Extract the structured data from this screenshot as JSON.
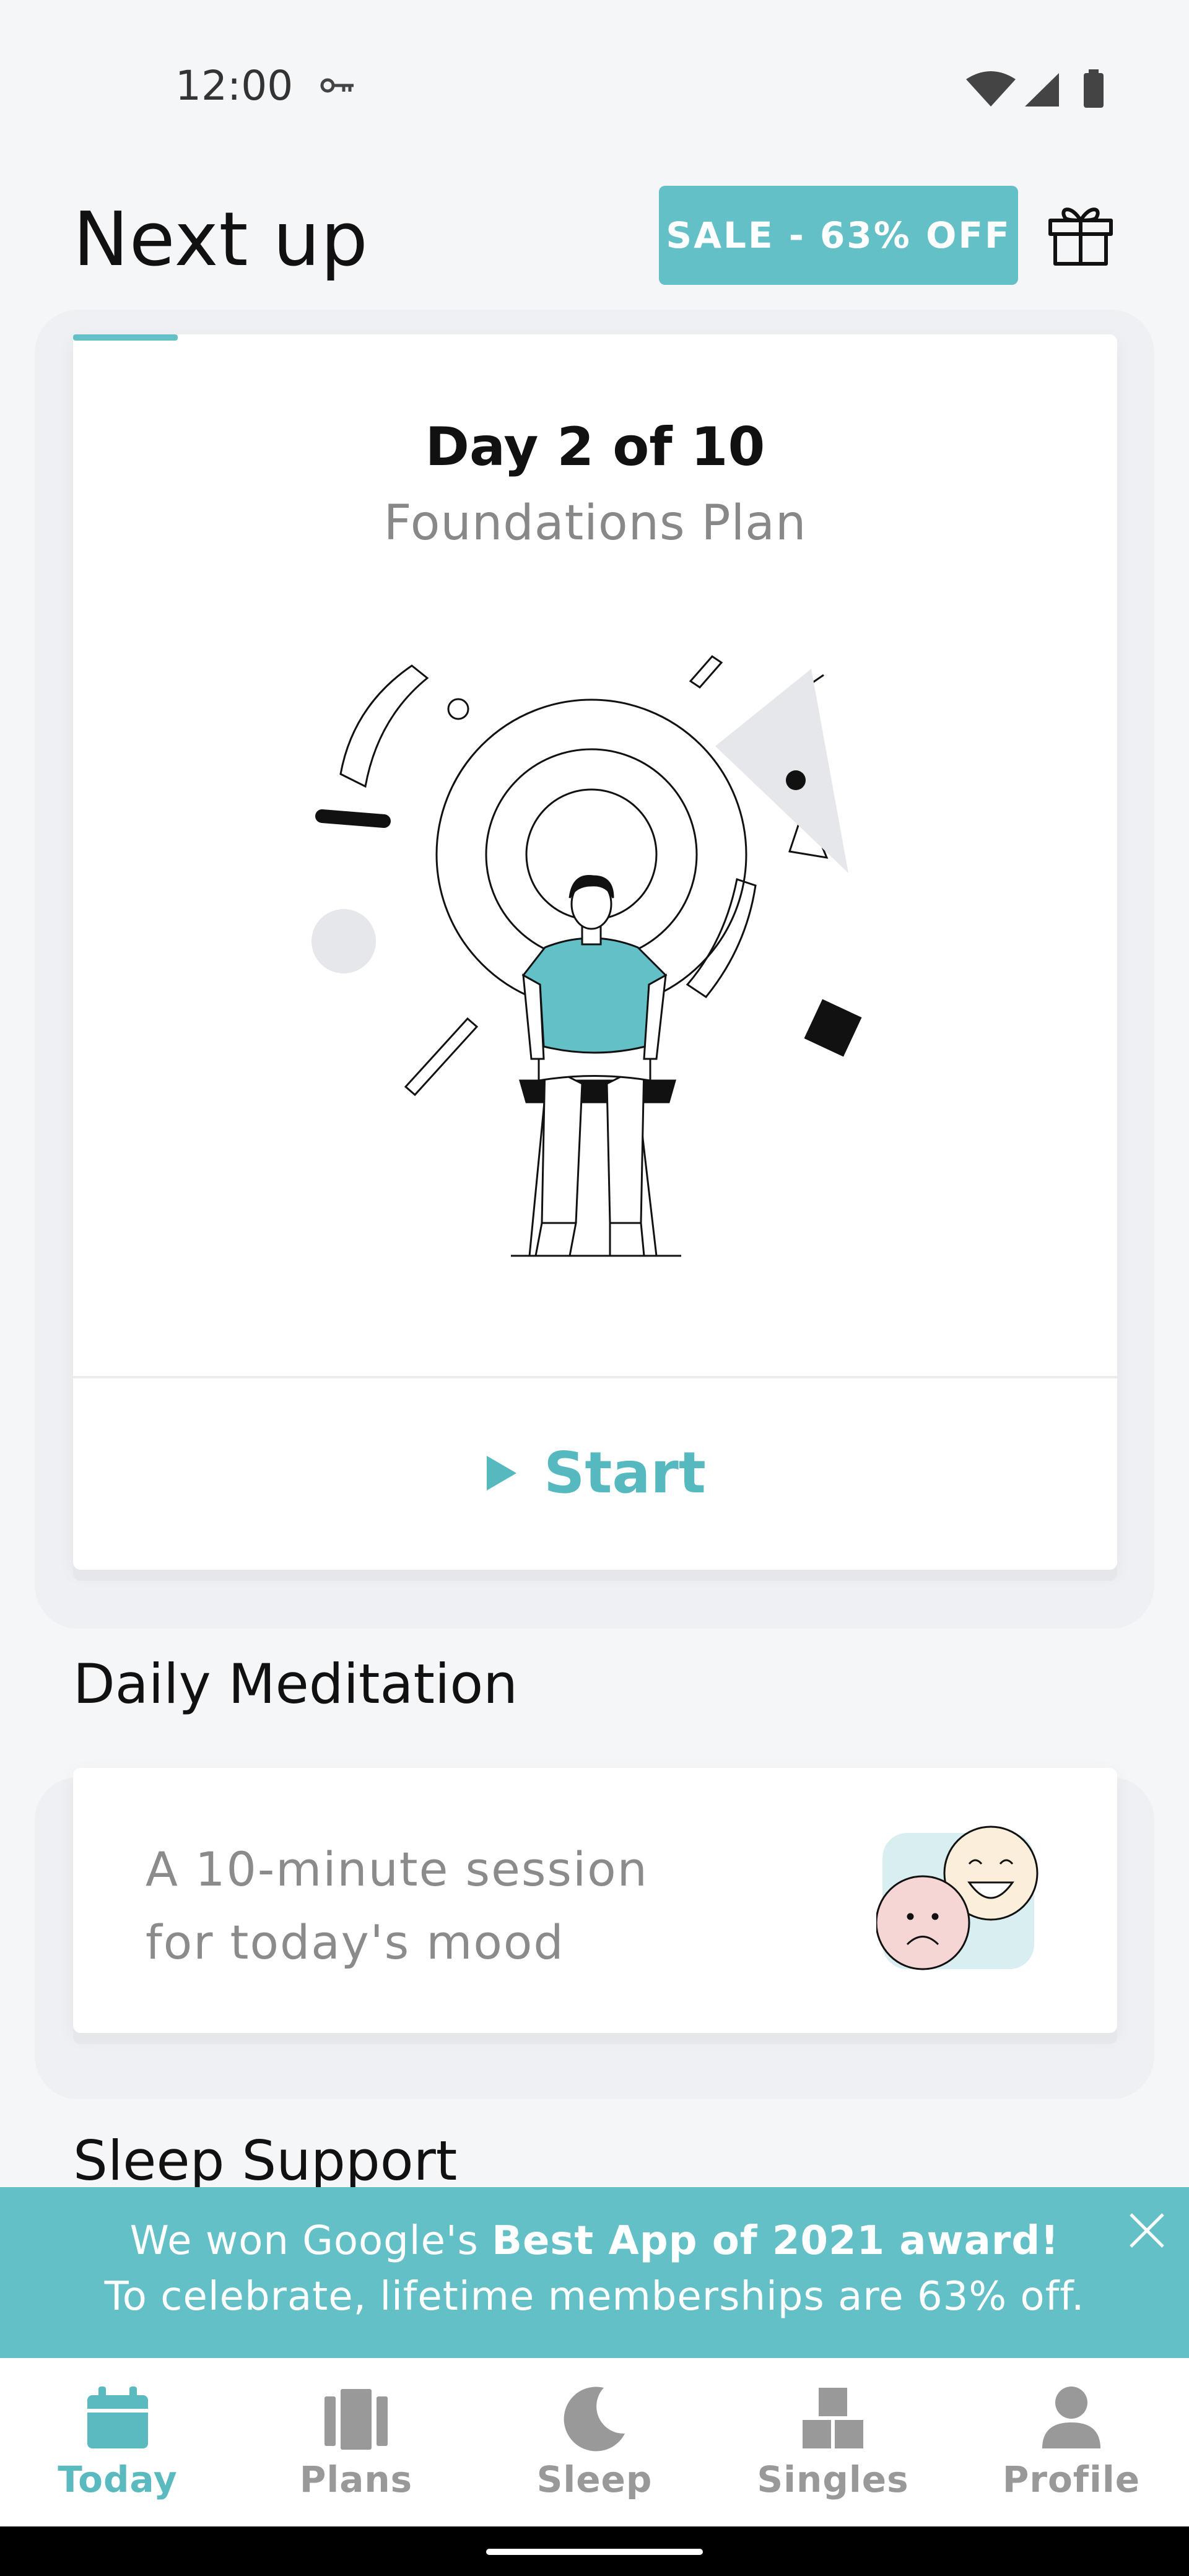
{
  "status_bar": {
    "time": "12:00",
    "key_icon": "key-icon",
    "wifi_icon": "wifi-icon",
    "signal_icon": "signal-icon",
    "battery_icon": "battery-icon"
  },
  "header": {
    "title": "Next up",
    "sale_label": "SALE - 63% OFF",
    "gift_icon": "gift-icon"
  },
  "plan_card": {
    "progress_fraction": 0.1,
    "day_label": "Day 2 of 10",
    "plan_name": "Foundations Plan",
    "start_label": "Start"
  },
  "daily_meditation": {
    "title": "Daily Meditation",
    "line1": "A 10-minute session",
    "line2": "for today's mood"
  },
  "sleep_support": {
    "title": "Sleep Support"
  },
  "promo_banner": {
    "line1_prefix": "We won Google's ",
    "line1_bold": "Best App of 2021 award!",
    "line2": "To celebrate, lifetime memberships are 63% off."
  },
  "bottom_nav": {
    "items": [
      {
        "label": "Today",
        "icon": "calendar-icon",
        "active": true
      },
      {
        "label": "Plans",
        "icon": "plans-icon",
        "active": false
      },
      {
        "label": "Sleep",
        "icon": "moon-icon",
        "active": false
      },
      {
        "label": "Singles",
        "icon": "blocks-icon",
        "active": false
      },
      {
        "label": "Profile",
        "icon": "person-icon",
        "active": false
      }
    ]
  },
  "colors": {
    "accent": "#63c0c6",
    "background": "#f5f6f8"
  }
}
